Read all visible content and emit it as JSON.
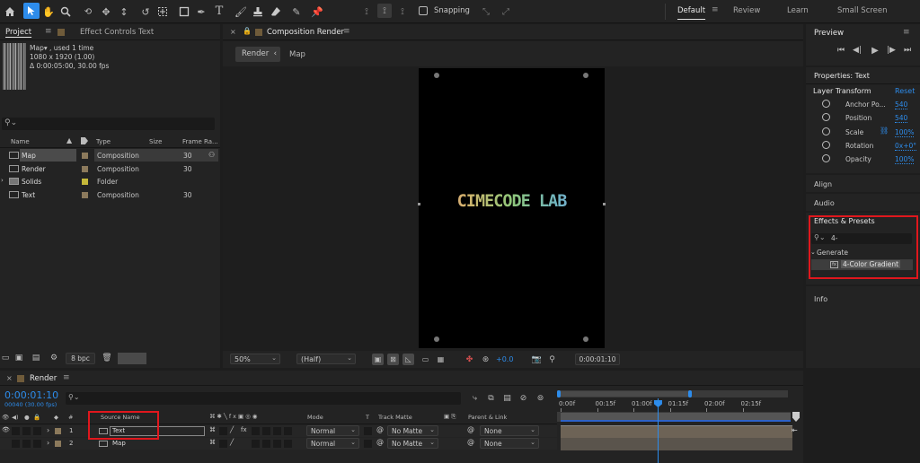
{
  "toolbar": {
    "snapping_label": "Snapping",
    "workspaces": [
      "Default",
      "Review",
      "Learn",
      "Small Screen"
    ],
    "active_workspace_index": 0
  },
  "project": {
    "tab_label": "Project",
    "effect_controls_tab": "Effect Controls Text",
    "comp_info_name": "Map▾ , used 1 time",
    "comp_info_size": "1080 x 1920 (1.00)",
    "comp_info_duration": "Δ 0:00:05:00, 30.00 fps",
    "search_placeholder": "",
    "columns": [
      "Name",
      "Type",
      "Size",
      "Frame Ra..."
    ],
    "items": [
      {
        "name": "Map",
        "type": "Composition",
        "fps": "30",
        "color": "#8c7a5c",
        "kind": "comp",
        "selected": true
      },
      {
        "name": "Render",
        "type": "Composition",
        "fps": "30",
        "color": "#8c7a5c",
        "kind": "comp",
        "selected": false
      },
      {
        "name": "Solids",
        "type": "Folder",
        "fps": "",
        "color": "#c5b83a",
        "kind": "folder",
        "selected": false
      },
      {
        "name": "Text",
        "type": "Composition",
        "fps": "30",
        "color": "#8c7a5c",
        "kind": "comp",
        "selected": false
      }
    ],
    "bpc_label": "8 bpc"
  },
  "composition": {
    "tab_label": "Composition Render",
    "breadcrumbs": [
      "Render",
      "Map"
    ],
    "canvas_text": "CIMECODE LAB",
    "zoom": "50%",
    "resolution": "(Half)",
    "exposure": "+0.0",
    "timecode": "0:00:01:10"
  },
  "right": {
    "preview_title": "Preview",
    "properties_title": "Properties: Text",
    "layer_transform": "Layer Transform",
    "reset_label": "Reset",
    "props": [
      {
        "name": "Anchor Po...",
        "value": "540",
        "extra": ""
      },
      {
        "name": "Position",
        "value": "540",
        "extra": ""
      },
      {
        "name": "Scale",
        "value": "100%",
        "extra": "link"
      },
      {
        "name": "Rotation",
        "value": "0x+0°",
        "extra": ""
      },
      {
        "name": "Opacity",
        "value": "100%",
        "extra": ""
      }
    ],
    "align_title": "Align",
    "audio_title": "Audio",
    "effects_title": "Effects & Presets",
    "effects_search": "4-",
    "generate_group": "Generate",
    "effect_item": "4-Color Gradient",
    "info_title": "Info"
  },
  "timeline": {
    "tab_label": "Render",
    "timecode": "0:00:01:10",
    "frame_info": "00040 (30.00 fps)",
    "columns": {
      "source_name": "Source Name",
      "mode": "Mode",
      "t": "T",
      "track_matte": "Track Matte",
      "parent": "Parent & Link"
    },
    "layers": [
      {
        "num": "1",
        "name": "Text",
        "mode": "Normal",
        "matte": "No Matte",
        "parent": "None",
        "color": "#8c7a5c"
      },
      {
        "num": "2",
        "name": "Map",
        "mode": "Normal",
        "matte": "No Matte",
        "parent": "None",
        "color": "#8c7a5c"
      }
    ],
    "ruler_labels": [
      "0:00f",
      "00:15f",
      "01:00f",
      "01:15f",
      "02:00f",
      "02:15f"
    ],
    "playhead_position_s": 1.333
  },
  "colors": {
    "accent": "#2d8ceb",
    "highlight_red": "#e0171d",
    "panel": "#232323"
  }
}
